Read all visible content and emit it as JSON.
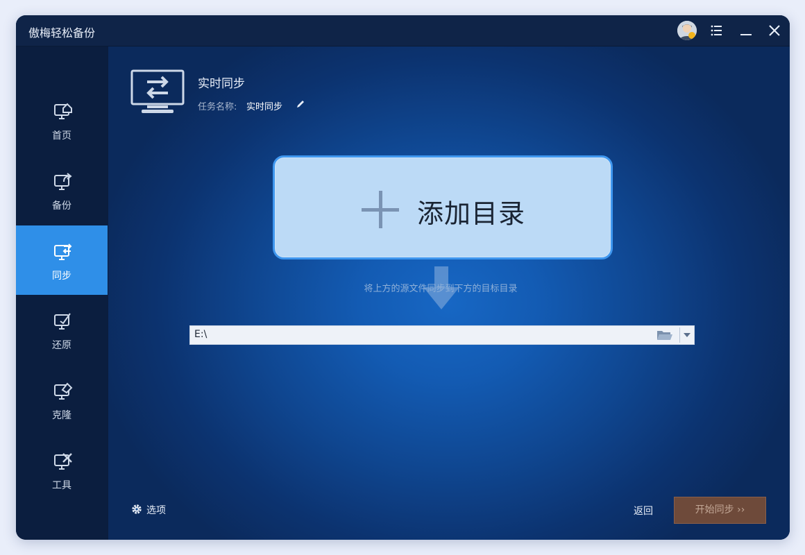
{
  "app": {
    "title": "傲梅轻松备份"
  },
  "sidebar": {
    "items": [
      {
        "label": "首页",
        "icon": "home-monitor-icon"
      },
      {
        "label": "备份",
        "icon": "backup-monitor-icon"
      },
      {
        "label": "同步",
        "icon": "sync-monitor-icon",
        "active": true
      },
      {
        "label": "还原",
        "icon": "restore-monitor-icon"
      },
      {
        "label": "克隆",
        "icon": "clone-monitor-icon"
      },
      {
        "label": "工具",
        "icon": "tools-monitor-icon"
      }
    ]
  },
  "task": {
    "title": "实时同步",
    "name_label": "任务名称:",
    "name_value": "实时同步"
  },
  "source": {
    "add_label": "添加目录"
  },
  "hint": "将上方的源文件同步到下方的目标目录",
  "destination": {
    "value": "E:\\"
  },
  "footer": {
    "options_label": "选项",
    "back_label": "返回",
    "start_label": "开始同步 ››"
  },
  "colors": {
    "accent": "#2f8fe8",
    "sidebar_bg": "#0b1e3f",
    "start_button": "#6e4a3a"
  }
}
